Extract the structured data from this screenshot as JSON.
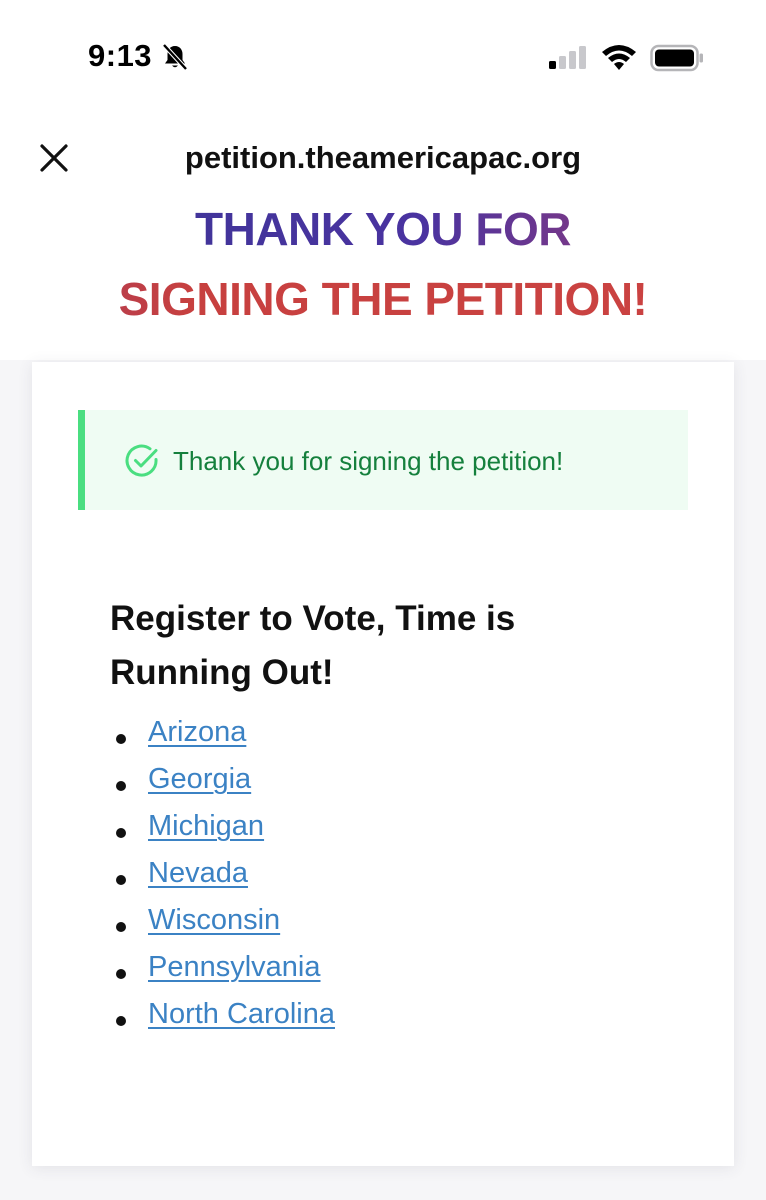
{
  "status_bar": {
    "time": "9:13",
    "icons": [
      "bell-muted-icon",
      "cellular-signal-icon",
      "wifi-icon",
      "battery-icon"
    ]
  },
  "browser": {
    "close_icon": "close-icon",
    "url": "petition.theamericapac.org"
  },
  "hero": {
    "line1": "THANK YOU FOR",
    "line2": "SIGNING THE PETITION!"
  },
  "card": {
    "alert": {
      "icon": "check-circle-icon",
      "text": "Thank you for signing the petition!"
    },
    "heading": "Register to Vote, Time is Running Out!",
    "states": [
      {
        "label": "Arizona"
      },
      {
        "label": "Georgia"
      },
      {
        "label": "Michigan"
      },
      {
        "label": "Nevada"
      },
      {
        "label": "Wisconsin"
      },
      {
        "label": "Pennsylvania"
      },
      {
        "label": "North Carolina"
      }
    ]
  },
  "colors": {
    "hero_purple": "#3b3595",
    "hero_red": "#c7403f",
    "alert_green_text": "#15803d",
    "alert_border": "#4ade80",
    "alert_bg": "#effcf3",
    "link_blue": "#3b82c4"
  }
}
